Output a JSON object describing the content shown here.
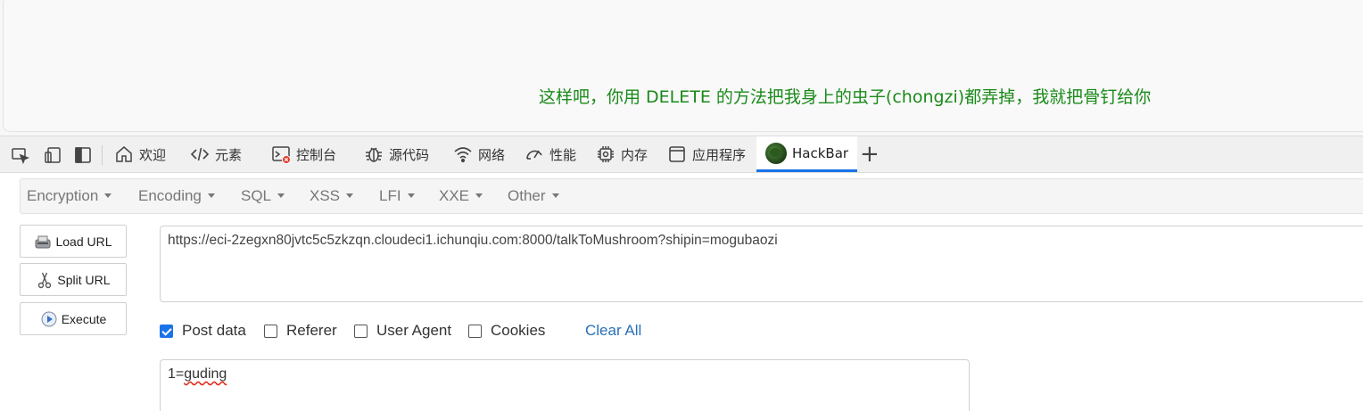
{
  "page": {
    "message": "这样吧，你用 DELETE 的方法把我身上的虫子(chongzi)都弄掉，我就把骨钉给你"
  },
  "devtools": {
    "tabs": [
      {
        "label": "欢迎",
        "icon": "home-icon"
      },
      {
        "label": "元素",
        "icon": "code-icon"
      },
      {
        "label": "控制台",
        "icon": "console-icon"
      },
      {
        "label": "源代码",
        "icon": "bug-icon"
      },
      {
        "label": "网络",
        "icon": "wifi-icon"
      },
      {
        "label": "性能",
        "icon": "gauge-icon"
      },
      {
        "label": "内存",
        "icon": "chip-icon"
      },
      {
        "label": "应用程序",
        "icon": "window-icon"
      },
      {
        "label": "HackBar",
        "icon": "hackbar-logo-icon"
      }
    ],
    "active_tab": "HackBar",
    "add_tab_label": "+",
    "accent_color": "#1a73e8"
  },
  "hackbar": {
    "menus": [
      "Encryption",
      "Encoding",
      "SQL",
      "XSS",
      "LFI",
      "XXE",
      "Other"
    ],
    "buttons": {
      "load_url": "Load URL",
      "split_url": "Split URL",
      "execute": "Execute"
    },
    "url": "https://eci-2zegxn80jvtc5c5zkzqn.cloudeci1.ichunqiu.com:8000/talkToMushroom?shipin=mogubaozi",
    "options": [
      {
        "label": "Post data",
        "checked": true
      },
      {
        "label": "Referer",
        "checked": false
      },
      {
        "label": "User Agent",
        "checked": false
      },
      {
        "label": "Cookies",
        "checked": false
      }
    ],
    "clear_all": "Clear All",
    "post_data_prefix": "1=",
    "post_data_word": "guding"
  }
}
